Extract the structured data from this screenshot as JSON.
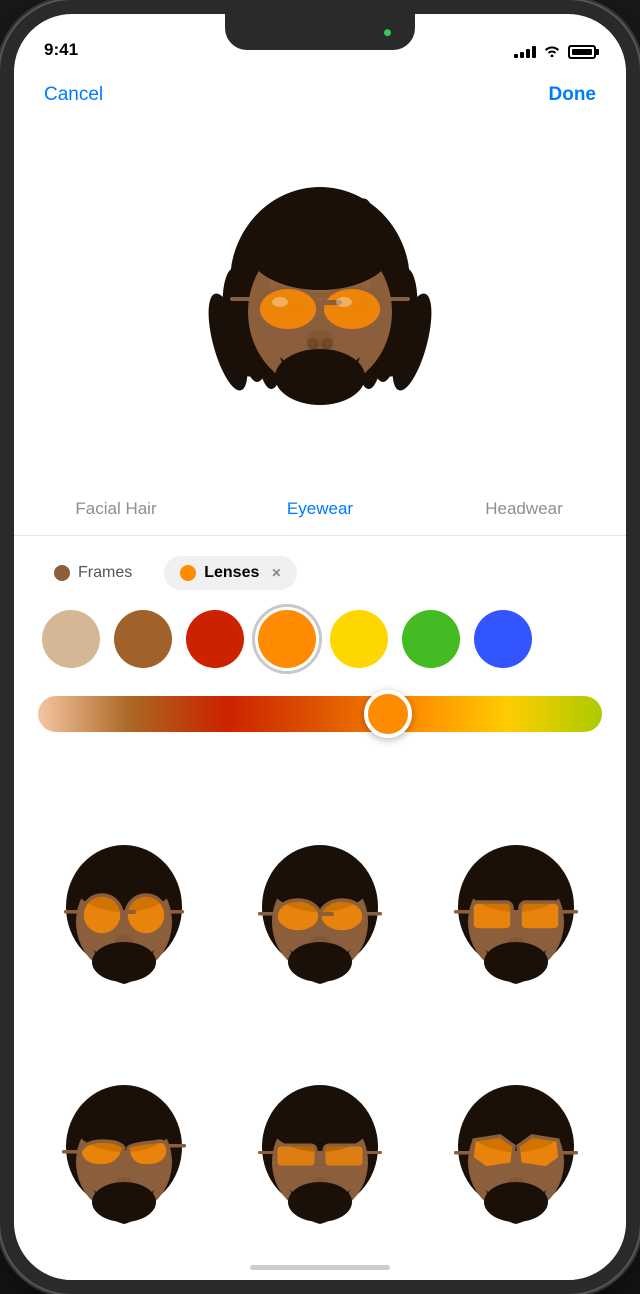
{
  "statusBar": {
    "time": "9:41",
    "signalBars": [
      3,
      5,
      7,
      9,
      11
    ],
    "batteryLevel": "full"
  },
  "navigation": {
    "cancelLabel": "Cancel",
    "doneLabel": "Done"
  },
  "tabs": [
    {
      "id": "facial-hair",
      "label": "Facial Hair",
      "active": false
    },
    {
      "id": "eyewear",
      "label": "Eyewear",
      "active": true
    },
    {
      "id": "headwear",
      "label": "Headwear",
      "active": false
    }
  ],
  "colorPicker": {
    "chips": [
      {
        "id": "frames",
        "label": "Frames",
        "color": "#8B5E3C",
        "active": false
      },
      {
        "id": "lenses",
        "label": "Lenses",
        "color": "#FF8C00",
        "active": true,
        "hasClose": true
      }
    ],
    "swatches": [
      {
        "id": "sw1",
        "color": "#D4B896",
        "selected": false
      },
      {
        "id": "sw2",
        "color": "#A0622A",
        "selected": false
      },
      {
        "id": "sw3",
        "color": "#CC2200",
        "selected": false
      },
      {
        "id": "sw4",
        "color": "#FF8C00",
        "selected": true
      },
      {
        "id": "sw5",
        "color": "#FFD700",
        "selected": false
      },
      {
        "id": "sw6",
        "color": "#44BB22",
        "selected": false
      },
      {
        "id": "sw7",
        "color": "#3355FF",
        "selected": false
      }
    ],
    "slider": {
      "thumbPosition": 62,
      "trackGradient": "linear-gradient(to right, #f5c5a3, #cc7722, #cc2200, #dd5500, #ff8c00, #ffcc00, #aacc00)"
    }
  },
  "eyewearGrid": {
    "items": [
      {
        "id": "ew1"
      },
      {
        "id": "ew2"
      },
      {
        "id": "ew3"
      },
      {
        "id": "ew4"
      },
      {
        "id": "ew5"
      },
      {
        "id": "ew6"
      }
    ]
  }
}
